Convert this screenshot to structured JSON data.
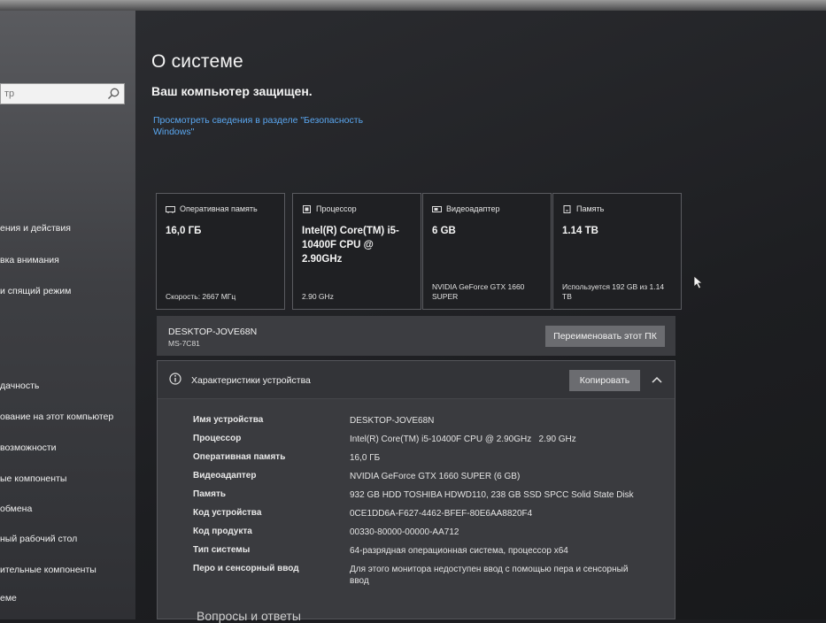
{
  "sidebar": {
    "search_placeholder": "тр",
    "items": [
      {
        "label": "ения и действия"
      },
      {
        "label": "вка внимания"
      },
      {
        "label": "и спящий режим"
      },
      {
        "label": "дачность"
      },
      {
        "label": "ование на этот компьютер"
      },
      {
        "label": "возможности"
      },
      {
        "label": "ые компоненты"
      },
      {
        "label": "обмена"
      },
      {
        "label": "ный рабочий стол"
      },
      {
        "label": "ительные компоненты"
      },
      {
        "label": "еме"
      }
    ]
  },
  "header": {
    "title": "О системе",
    "protection_status": "Ваш компьютер защищен.",
    "security_link": "Просмотреть сведения в разделе \"Безопасность Windows\""
  },
  "cards": [
    {
      "icon": "memory-icon",
      "title": "Оперативная память",
      "value": "16,0 ГБ",
      "footer": "Скорость: 2667 МГц"
    },
    {
      "icon": "processor-icon",
      "title": "Процессор",
      "value": "Intel(R) Core(TM) i5-10400F CPU @ 2.90GHz",
      "footer": "2.90 GHz"
    },
    {
      "icon": "video-adapter-icon",
      "title": "Видеоадаптер",
      "value": "6 GB",
      "footer": "NVIDIA GeForce GTX 1660 SUPER"
    },
    {
      "icon": "storage-icon",
      "title": "Память",
      "value": "1.14 TB",
      "footer": "Используется 192 GB из 1.14 TB"
    }
  ],
  "device": {
    "name": "DESKTOP-JOVE68N",
    "model": "MS-7C81",
    "rename_label": "Переименовать этот ПК"
  },
  "specs": {
    "title": "Характеристики устройства",
    "copy_label": "Копировать",
    "rows": [
      {
        "label": "Имя устройства",
        "value": "DESKTOP-JOVE68N"
      },
      {
        "label": "Процессор",
        "value": "Intel(R) Core(TM) i5-10400F CPU @ 2.90GHz   2.90 GHz"
      },
      {
        "label": "Оперативная память",
        "value": "16,0 ГБ"
      },
      {
        "label": "Видеоадаптер",
        "value": "NVIDIA GeForce GTX 1660 SUPER (6 GB)"
      },
      {
        "label": "Память",
        "value": "932 GB HDD TOSHIBA HDWD110, 238 GB SSD SPCC Solid State Disk"
      },
      {
        "label": "Код устройства",
        "value": "0CE1DD6A-F627-4462-BFEF-80E6AA8820F4"
      },
      {
        "label": "Код продукта",
        "value": "00330-80000-00000-AA712"
      },
      {
        "label": "Тип системы",
        "value": "64-разрядная операционная система, процессор x64"
      },
      {
        "label": "Перо и сенсорный ввод",
        "value": "Для этого монитора недоступен ввод с помощью пера и сенсорный ввод"
      }
    ]
  },
  "footer": {
    "qa_title": "Вопросы и ответы"
  },
  "colors": {
    "link": "#5aa7f0",
    "background": "#1c1d20",
    "button": "#6b6c70"
  }
}
